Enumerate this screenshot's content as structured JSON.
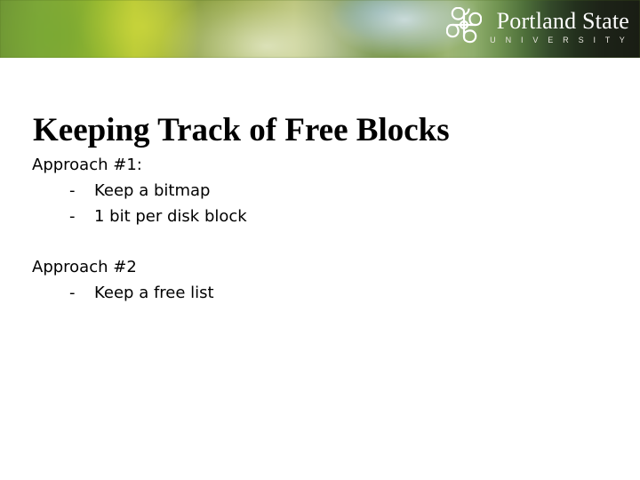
{
  "header": {
    "logo": {
      "mark_icon": "psu-interlocking-knot-icon",
      "name": "Portland State",
      "subtitle": "U N I V E R S I T Y"
    }
  },
  "slide": {
    "title": "Keeping Track of Free Blocks",
    "blocks": [
      {
        "lead": "Approach #1:",
        "bullets": [
          {
            "marker": "-",
            "text": "Keep a bitmap"
          },
          {
            "marker": "-",
            "text": "1 bit per disk block"
          }
        ]
      },
      {
        "lead": "Approach #2",
        "bullets": [
          {
            "marker": "-",
            "text": "Keep a free list"
          }
        ]
      }
    ]
  },
  "colors": {
    "page_background": "#ffffff",
    "text": "#000000",
    "banner_green": "#8da045",
    "banner_bright_green": "#bccb36",
    "banner_dark_edge": "#191d14",
    "logo_white": "#ffffff"
  }
}
